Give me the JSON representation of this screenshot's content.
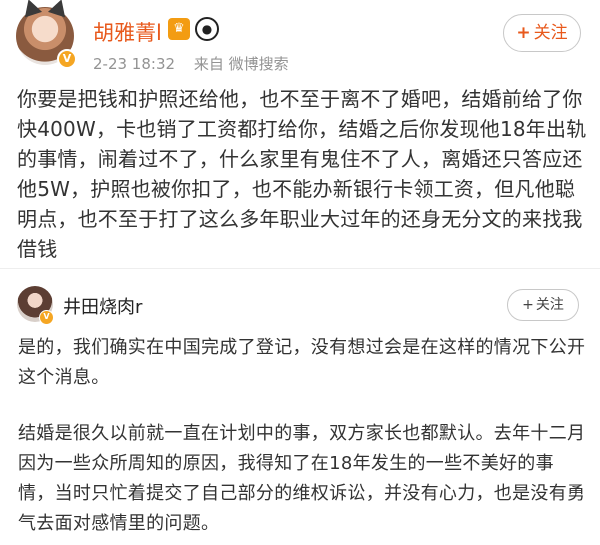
{
  "post": {
    "author": "胡雅菁l",
    "time": "2-23 18:32",
    "source": "来自 微博搜索",
    "follow_label": "关注",
    "follow_plus": "+",
    "text": "你要是把钱和护照还给他，也不至于离不了婚吧，结婚前给了你快400W，卡也销了工资都打给你，结婚之后你发现他18年出轨的事情，闹着过不了，什么家里有鬼住不了人，离婚还只答应还他5W，护照也被你扣了，也不能办新银行卡领工资，但凡他聪明点，也不至于打了这么多年职业大过年的还身无分文的来找我借钱"
  },
  "embedded": {
    "author": "井田烧肉r",
    "follow_label": "关注",
    "follow_plus": "+",
    "paragraph1": "是的，我们确实在中国完成了登记，没有想过会是在这样的情况下公开这个消息。",
    "paragraph2": "结婚是很久以前就一直在计划中的事，双方家长也都默认。去年十二月因为一些众所周知的原因，我得知了在18年发生的一些不美好的事情，当时只忙着提交了自己部分的维权诉讼，并没有心力，也是没有勇气去面对感情里的问题。"
  },
  "icons": {
    "verified": "verified-badge-icon",
    "crown": "crown-badge-icon",
    "panda": "panda-badge-icon",
    "avatar_ears": "cat-ears-icon"
  },
  "colors": {
    "name_accent": "#e8591c",
    "verified": "#f5a623",
    "meta": "#939393",
    "text": "#333333"
  }
}
